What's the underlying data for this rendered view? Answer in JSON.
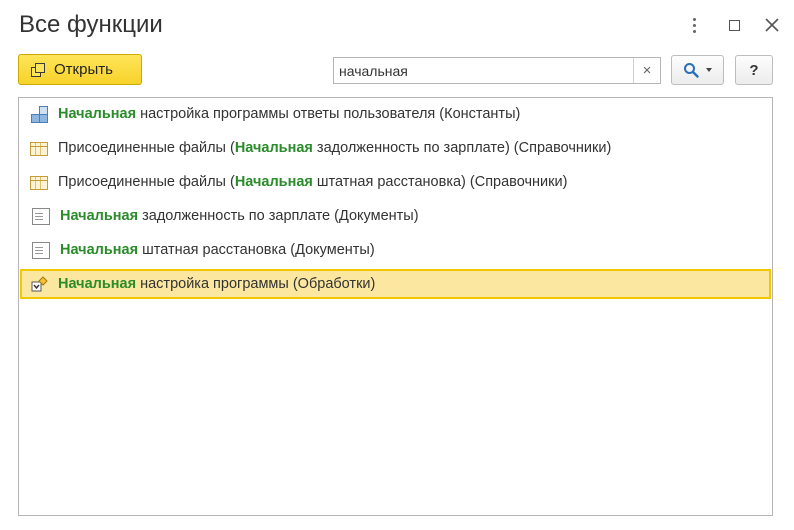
{
  "window": {
    "title": "Все функции"
  },
  "toolbar": {
    "open_label": "Открыть",
    "search_value": "начальная",
    "clear_label": "×",
    "help_label": "?"
  },
  "items": [
    {
      "icon": "constants-icon",
      "before": "",
      "highlight": "Начальная",
      "after": " настройка программы ответы пользователя (Константы)"
    },
    {
      "icon": "catalog-table-icon",
      "before": "Присоединенные файлы (",
      "highlight": "Начальная",
      "after": " задолженность по зарплате) (Справочники)"
    },
    {
      "icon": "catalog-table-icon",
      "before": "Присоединенные файлы (",
      "highlight": "Начальная",
      "after": " штатная расстановка) (Справочники)"
    },
    {
      "icon": "document-icon",
      "before": "",
      "highlight": "Начальная",
      "after": " задолженность по зарплате (Документы)"
    },
    {
      "icon": "document-icon",
      "before": "",
      "highlight": "Начальная",
      "after": " штатная расстановка (Документы)"
    },
    {
      "icon": "data-processor-icon",
      "before": "",
      "highlight": "Начальная",
      "after": " настройка программы (Обработки)",
      "selected": true
    }
  ],
  "colors": {
    "accent_button": "#f7d22a",
    "match_highlight": "#2a8c2a",
    "selected_row": "#fbe7a0",
    "selected_border": "#f0c800"
  }
}
